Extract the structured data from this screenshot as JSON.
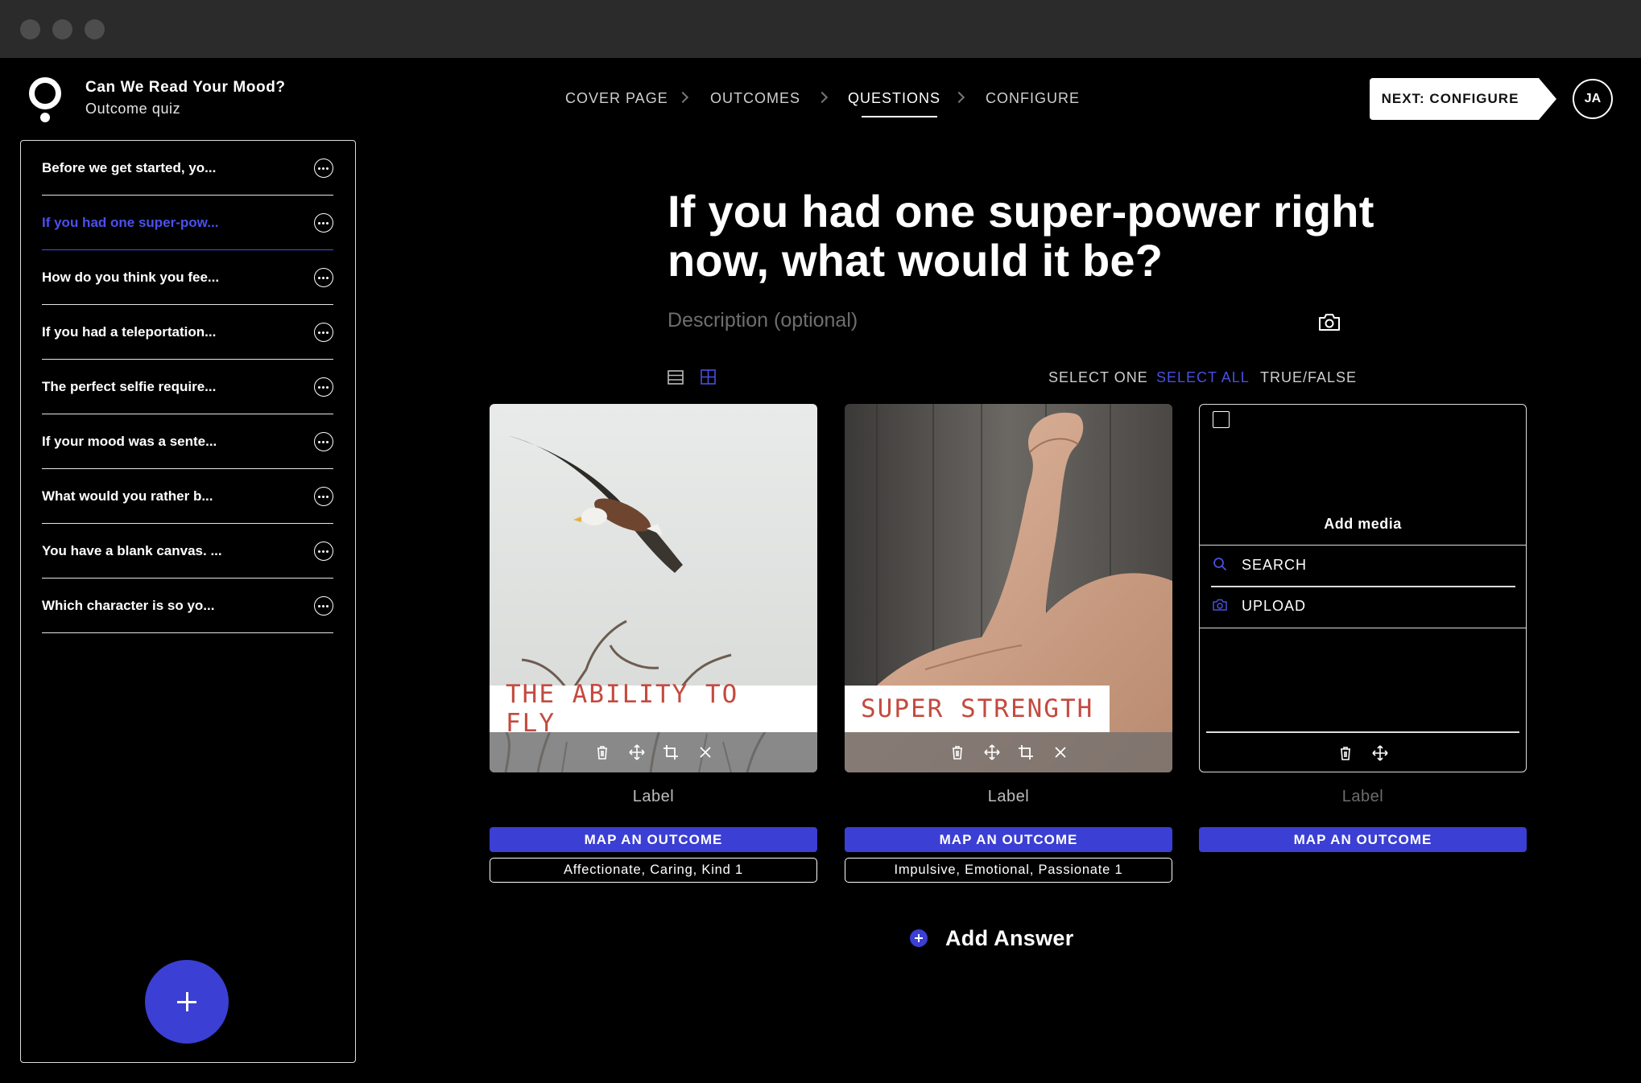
{
  "app": {
    "quiz_title": "Can We Read Your Mood?",
    "quiz_subtitle": "Outcome quiz",
    "avatar_initials": "JA",
    "next_button": "NEXT: CONFIGURE"
  },
  "steps": [
    {
      "label": "COVER PAGE",
      "active": false
    },
    {
      "label": "OUTCOMES",
      "active": false
    },
    {
      "label": "QUESTIONS",
      "active": true
    },
    {
      "label": "CONFIGURE",
      "active": false
    }
  ],
  "sidebar": {
    "items": [
      {
        "label": "Before we get started, yo...",
        "active": false
      },
      {
        "label": "If you had one super-pow...",
        "active": true
      },
      {
        "label": "How do you think you fee...",
        "active": false
      },
      {
        "label": "If you had a teleportation...",
        "active": false
      },
      {
        "label": "The perfect selfie require...",
        "active": false
      },
      {
        "label": "If your mood was a sente...",
        "active": false
      },
      {
        "label": "What would you rather b...",
        "active": false
      },
      {
        "label": "You have a blank canvas. ...",
        "active": false
      },
      {
        "label": "Which character is so yo...",
        "active": false
      }
    ]
  },
  "question": {
    "title": "If you had one super-power right now, what would it be?",
    "description_placeholder": "Description (optional)"
  },
  "answer_modes": [
    {
      "label": "SELECT ONE",
      "active": false
    },
    {
      "label": "SELECT ALL",
      "active": true
    },
    {
      "label": "TRUE/FALSE",
      "active": false
    }
  ],
  "answers": [
    {
      "caption": "THE ABILITY TO FLY",
      "label": "Label",
      "map_button": "MAP AN OUTCOME",
      "outcome": "Affectionate, Caring, Kind  1"
    },
    {
      "caption": "SUPER STRENGTH",
      "label": "Label",
      "map_button": "MAP AN OUTCOME",
      "outcome": "Impulsive, Emotional, Passionate  1"
    },
    {
      "add_media": "Add media",
      "search": "SEARCH",
      "upload": "UPLOAD",
      "label": "Label",
      "map_button": "MAP AN OUTCOME"
    }
  ],
  "add_answer": "Add Answer",
  "colors": {
    "accent": "#3b3fd3",
    "accent_text": "#4b50ee",
    "caption_text": "#c44a3f",
    "background": "#000000",
    "titlebar": "#2b2b2b"
  }
}
